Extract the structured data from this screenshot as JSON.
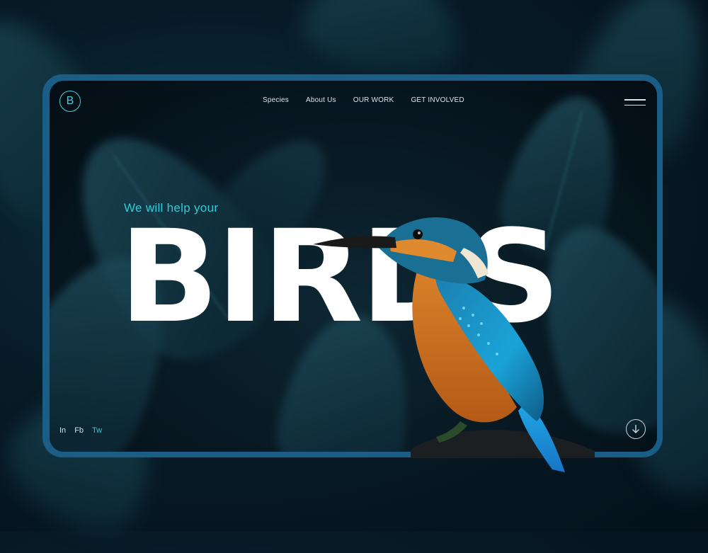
{
  "brand": {
    "logo_letter": "B"
  },
  "nav": {
    "items": [
      {
        "label": "Species"
      },
      {
        "label": "About Us"
      },
      {
        "label": "OUR WORK"
      },
      {
        "label": "GET INVOLVED"
      }
    ]
  },
  "hero": {
    "subtitle": "We will help your",
    "headline": "BIRDS"
  },
  "socials": [
    {
      "label": "In",
      "active": false
    },
    {
      "label": "Fb",
      "active": false
    },
    {
      "label": "Tw",
      "active": true
    }
  ],
  "icons": {
    "menu": "hamburger-icon",
    "scroll": "arrow-down-circle-icon",
    "bird": "kingfisher-image"
  },
  "colors": {
    "accent": "#32c9d8",
    "frame": "#1a5d86",
    "background": "#06141d",
    "headline": "#ffffff"
  }
}
